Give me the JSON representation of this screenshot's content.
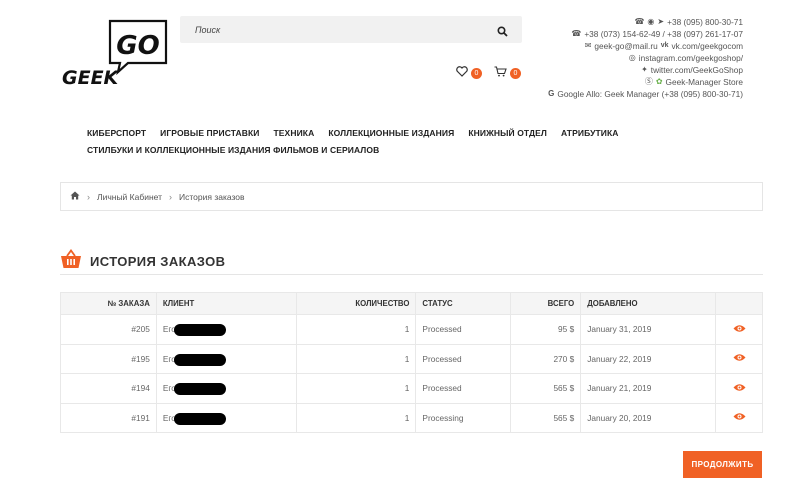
{
  "brand": {
    "logo_top": "GO",
    "logo_bottom": "GEEK"
  },
  "search": {
    "placeholder": "Поиск"
  },
  "header": {
    "wishlist_count": "0",
    "cart_count": "0"
  },
  "contacts": {
    "phone1": "+38 (095) 800-30-71",
    "phone2": "+38 (073) 154-62-49 / +38 (097) 261-17-07",
    "email": "geek-go@mail.ru",
    "vk": "vk.com/geekgocom",
    "instagram": "instagram.com/geekgoshop/",
    "twitter": "twitter.com/GeekGoShop",
    "skype": "Geek-Manager Store",
    "google_allo": "Google Allo: Geek Manager (+38 (095) 800-30-71)"
  },
  "nav": {
    "row1": [
      "КИБЕРСПОРТ",
      "ИГРОВЫЕ ПРИСТАВКИ",
      "ТЕХНИКА",
      "КОЛЛЕКЦИОННЫЕ ИЗДАНИЯ",
      "КНИЖНЫЙ ОТДЕЛ",
      "АТРИБУТИКА"
    ],
    "row2": [
      "СТИЛБУКИ И КОЛЛЕКЦИОННЫЕ ИЗДАНИЯ ФИЛЬМОВ И СЕРИАЛОВ"
    ]
  },
  "breadcrumb": {
    "item1": "Личный Кабинет",
    "item2": "История заказов"
  },
  "page": {
    "title": "ИСТОРИЯ ЗАКАЗОВ"
  },
  "table": {
    "headers": [
      "№ заказа",
      "Клиент",
      "Количество",
      "Статус",
      "Всего",
      "Добавлено"
    ],
    "rows": [
      {
        "id": "#205",
        "client": "Егор",
        "qty": "1",
        "status": "Processed",
        "total": "95 $",
        "date": "January 31, 2019"
      },
      {
        "id": "#195",
        "client": "Егор",
        "qty": "1",
        "status": "Processed",
        "total": "270 $",
        "date": "January 22, 2019"
      },
      {
        "id": "#194",
        "client": "Егор",
        "qty": "1",
        "status": "Processed",
        "total": "565 $",
        "date": "January 21, 2019"
      },
      {
        "id": "#191",
        "client": "Егор",
        "qty": "1",
        "status": "Processing",
        "total": "565 $",
        "date": "January 20, 2019"
      }
    ]
  },
  "actions": {
    "continue": "ПРОДОЛЖИТЬ"
  },
  "colors": {
    "accent": "#f06125",
    "text": "#333333"
  }
}
